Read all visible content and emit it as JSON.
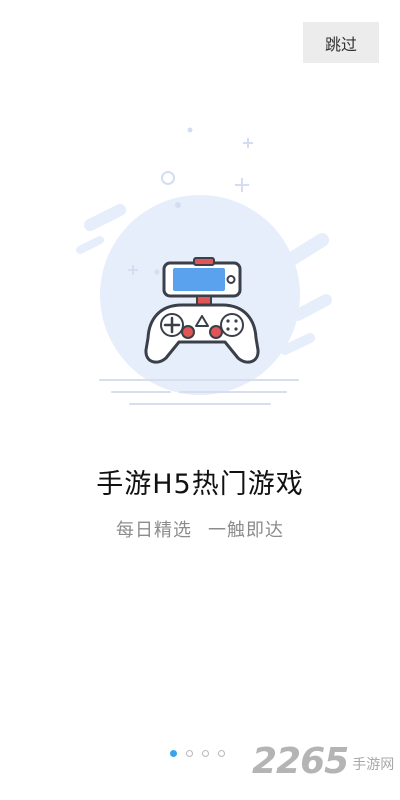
{
  "skip_button": {
    "label": "跳过"
  },
  "headline": "手游H5热门游戏",
  "subline": {
    "left": "每日精选",
    "right": "一触即达"
  },
  "pager": {
    "total": 4,
    "active": 0
  },
  "watermark": {
    "number": "2265",
    "site": "手游网"
  },
  "colors": {
    "accent": "#3ba3ea",
    "illustration_blue": "#e6eefb",
    "phone_screen": "#5aa2ee",
    "controller_red": "#e05555"
  }
}
